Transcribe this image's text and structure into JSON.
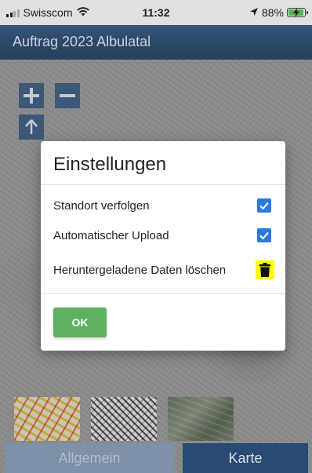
{
  "status_bar": {
    "carrier": "Swisscom",
    "time": "11:32",
    "battery": "88%",
    "battery_level": 0.88,
    "icons": [
      "signal-icon",
      "wifi-icon",
      "location-arrow-icon",
      "battery-charging-icon"
    ]
  },
  "header": {
    "title": "Auftrag 2023 Albulatal",
    "color": "#2f5075"
  },
  "map": {
    "controls": [
      {
        "name": "zoom-in",
        "icon": "plus-icon"
      },
      {
        "name": "zoom-out",
        "icon": "minus-icon"
      },
      {
        "name": "north-up",
        "icon": "arrow-up-icon"
      }
    ],
    "layers": [
      "layer-map-color",
      "layer-map-bw",
      "layer-aerial"
    ]
  },
  "tabs": {
    "allgemein": "Allgemein",
    "karte": "Karte",
    "active": "Karte"
  },
  "dialog": {
    "title": "Einstellungen",
    "rows": [
      {
        "label": "Standort verfolgen",
        "checked": true
      },
      {
        "label": "Automatischer Upload",
        "checked": true
      },
      {
        "label": "Heruntergeladene Daten löschen",
        "icon": "trash-icon",
        "highlight": "#ffff00"
      }
    ],
    "ok_label": "OK",
    "checkbox_color": "#2a7ae2",
    "ok_color": "#5fb15f"
  }
}
